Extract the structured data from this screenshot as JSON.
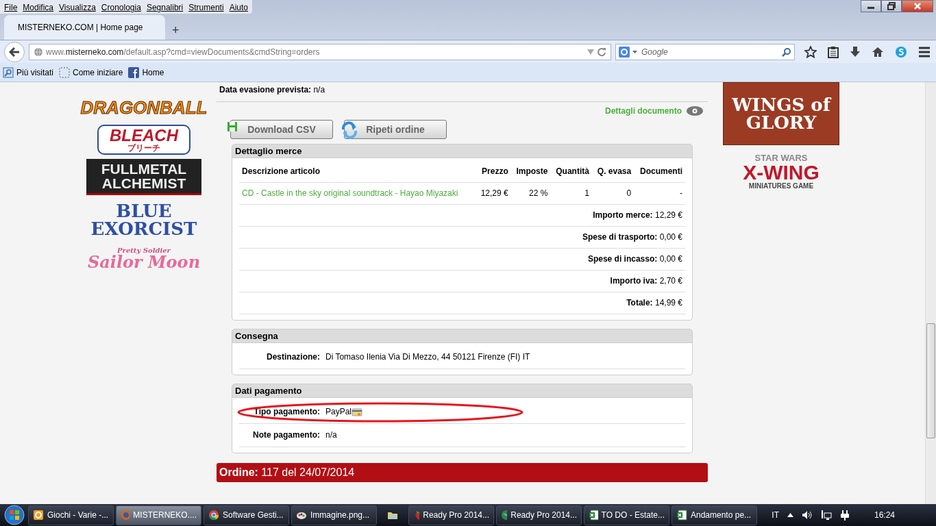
{
  "browser": {
    "menu": [
      "File",
      "Modifica",
      "Visualizza",
      "Cronologia",
      "Segnalibri",
      "Strumenti",
      "Aiuto"
    ],
    "tabs": [
      {
        "label": "MISTERNEKO.COM | Home page",
        "selected": true
      }
    ],
    "new_tab": "+",
    "url": "www.**misterneko.com**/default.asp?cmd=viewDocuments&cmdString=orders",
    "search": {
      "placeholder": "Google"
    },
    "bookmarks": [
      {
        "kind": "visited",
        "label": "Più visitati"
      },
      {
        "kind": "start",
        "label": "Come iniziare"
      },
      {
        "kind": "facebook",
        "label": "Home"
      }
    ]
  },
  "sidebar_left": [
    {
      "kind": "dragonball",
      "lines": [
        "DRAGONBALL"
      ]
    },
    {
      "kind": "bleach",
      "lines": [
        "BLEACH",
        "ブリーチ"
      ]
    },
    {
      "kind": "fma",
      "lines": [
        "FULLMETAL",
        "ALCHEMIST"
      ]
    },
    {
      "kind": "exorcist",
      "lines": [
        "BLUE",
        "EXORCIST"
      ]
    },
    {
      "kind": "sailor",
      "lines": [
        "Pretty Soldier",
        "Sailor Moon"
      ]
    }
  ],
  "sidebar_right": [
    {
      "kind": "wings",
      "lines": [
        "WINGS of GLORY"
      ]
    },
    {
      "kind": "xwing",
      "lines": [
        "STAR WARS",
        "X-WING",
        "MINIATURES GAME"
      ]
    }
  ],
  "order": {
    "shipping": {
      "label": "Data evasione prevista:",
      "value": "n/a"
    },
    "details_link": "Dettagli documento",
    "buttons": [
      {
        "kind": "csv",
        "label": "Download CSV"
      },
      {
        "kind": "repeat",
        "label": "Ripeti ordine"
      }
    ],
    "goods": {
      "title": "Dettaglio merce",
      "columns": [
        "Descrizione articolo",
        "Prezzo",
        "Imposte",
        "Quantità",
        "Q. evasa",
        "Documenti"
      ],
      "rows": [
        {
          "cells": [
            "CD - Castle in the sky original soundtrack - Hayao Miyazaki",
            "12,29 €",
            "22 %",
            "1",
            "0",
            "-"
          ]
        }
      ],
      "totals": [
        {
          "label": "Importo merce:",
          "value": "12,29 €"
        },
        {
          "label": "Spese di trasporto:",
          "value": "0,00 €"
        },
        {
          "label": "Spese di incasso:",
          "value": "0,00 €"
        },
        {
          "label": "Importo iva:",
          "value": "2,70 €"
        },
        {
          "label": "Totale:",
          "value": "14,99 €"
        }
      ]
    },
    "delivery": {
      "title": "Consegna",
      "fields": [
        {
          "label": "Destinazione:",
          "value": "Di Tomaso Ilenia Via Di Mezzo, 44 50121 Firenze (FI) IT"
        }
      ]
    },
    "payment": {
      "title": "Dati pagamento",
      "fields": [
        {
          "label": "Tipo pagamento:",
          "value": "PayPal",
          "kind": "card"
        },
        {
          "label": "Note pagamento:",
          "value": "n/a"
        }
      ]
    },
    "next_order": {
      "label": "Ordine:",
      "value": "117 del 24/07/2014"
    }
  },
  "taskbar": {
    "items": [
      {
        "kind": "outlook",
        "label": "Giochi - Varie -...",
        "selected": false
      },
      {
        "kind": "firefox",
        "label": "MISTERNEKO....",
        "selected": true
      },
      {
        "kind": "chrome",
        "label": "Software Gesti...",
        "selected": false
      },
      {
        "kind": "paint",
        "label": "Immagine.png...",
        "selected": false
      },
      {
        "kind": "folder",
        "selected": false
      },
      {
        "kind": "strawberry",
        "label": "Ready Pro 2014...",
        "selected": false
      },
      {
        "kind": "globe",
        "label": "Ready Pro 2014...",
        "selected": false
      },
      {
        "kind": "excel",
        "label": "TO DO - Estate...",
        "selected": false
      },
      {
        "kind": "excel",
        "label": "Andamento pe...",
        "selected": false
      }
    ],
    "language": "IT",
    "clock": "16:24"
  }
}
